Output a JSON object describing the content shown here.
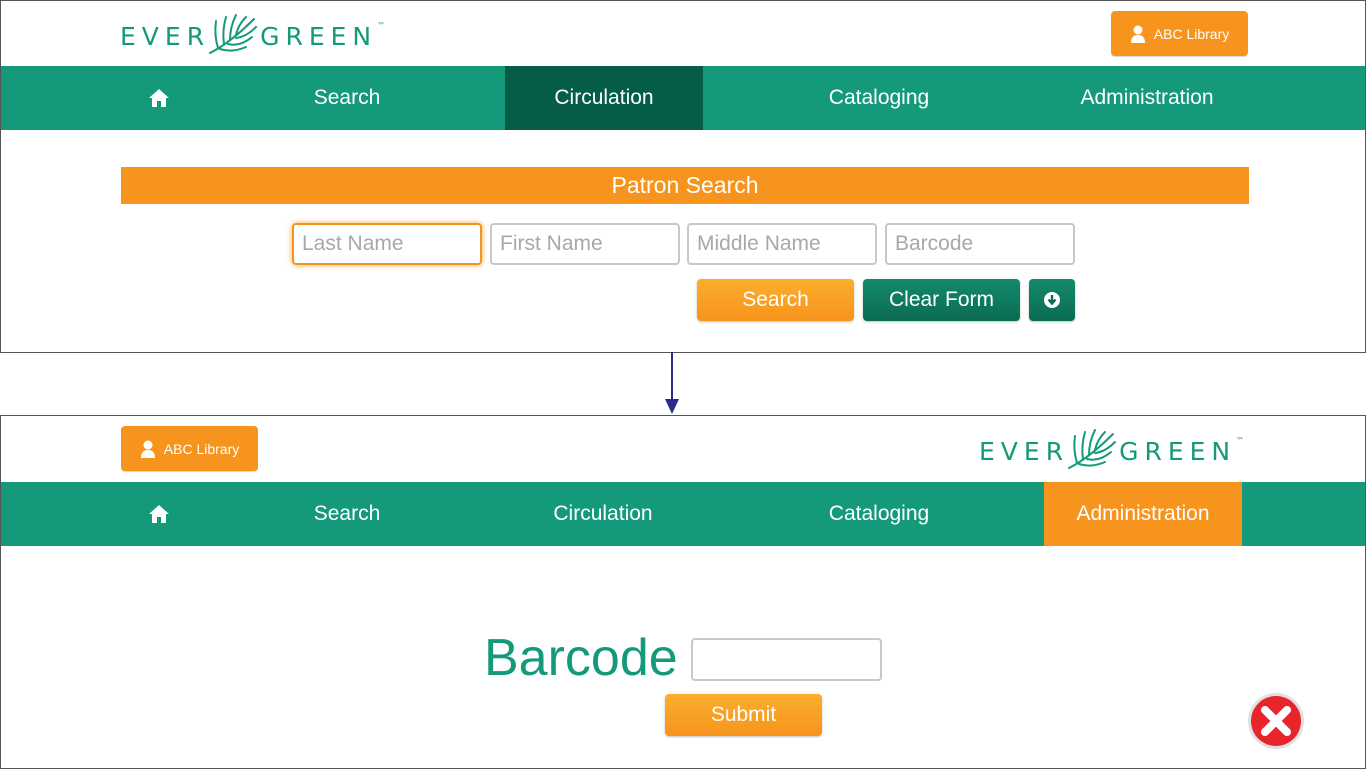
{
  "brand": {
    "logo_text_left": "EVER",
    "logo_text_right": "GREEN",
    "trademark": "™"
  },
  "user": {
    "label": "ABC Library"
  },
  "nav": {
    "home": "home-icon",
    "items": [
      "Search",
      "Circulation",
      "Cataloging",
      "Administration"
    ]
  },
  "top_screen": {
    "active_nav": "Circulation",
    "section_title": "Patron Search",
    "fields": [
      {
        "placeholder": "Last Name",
        "value": ""
      },
      {
        "placeholder": "First Name",
        "value": ""
      },
      {
        "placeholder": "Middle Name",
        "value": ""
      },
      {
        "placeholder": "Barcode",
        "value": ""
      }
    ],
    "buttons": {
      "search": "Search",
      "clear": "Clear Form",
      "more_icon": "arrow-down-circle-icon"
    }
  },
  "bottom_screen": {
    "active_nav": "Administration",
    "barcode_label": "Barcode",
    "barcode_value": "",
    "submit": "Submit",
    "close_icon": "close-icon"
  },
  "colors": {
    "green": "#149a7a",
    "dark_green": "#055c47",
    "orange": "#f7941d",
    "arrow": "#2b2b8c",
    "close_red": "#e8242c"
  }
}
